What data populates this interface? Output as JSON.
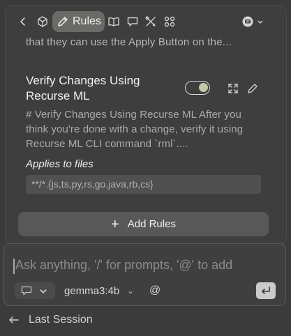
{
  "toolbar": {
    "active_tab_label": "Rules",
    "icons": [
      "back-chevron-icon",
      "cube-icon",
      "pencil-icon",
      "book-icon",
      "chat-bubble-icon",
      "tools-icon",
      "grid-icon",
      "assistant-icon",
      "chevron-down-icon"
    ]
  },
  "rules": {
    "previous_desc_tail": "that they can use the Apply Button on the...",
    "current": {
      "title": "Verify Changes Using Recurse ML",
      "enabled": true,
      "description": "# Verify Changes Using Recurse ML After you think you're done with a change, verify it using Recurse ML CLI command `rml`....",
      "applies_label": "Applies to files",
      "glob": "**/*.{js,ts,py,rs,go,java,rb,cs}"
    },
    "add_button_label": "Add Rules",
    "add_button_icon": "+"
  },
  "input": {
    "placeholder": "Ask anything, '/' for prompts, '@' to add",
    "model": "gemma3:4b",
    "model_chevron": "⌄",
    "at_symbol": "@"
  },
  "footer": {
    "last_session_label": "Last Session"
  },
  "colors": {
    "background": "#3b3b3b",
    "panel": "#3e3e3e",
    "active_tab": "#6a6a66",
    "button": "#585858",
    "submit": "#cbcbcb"
  }
}
